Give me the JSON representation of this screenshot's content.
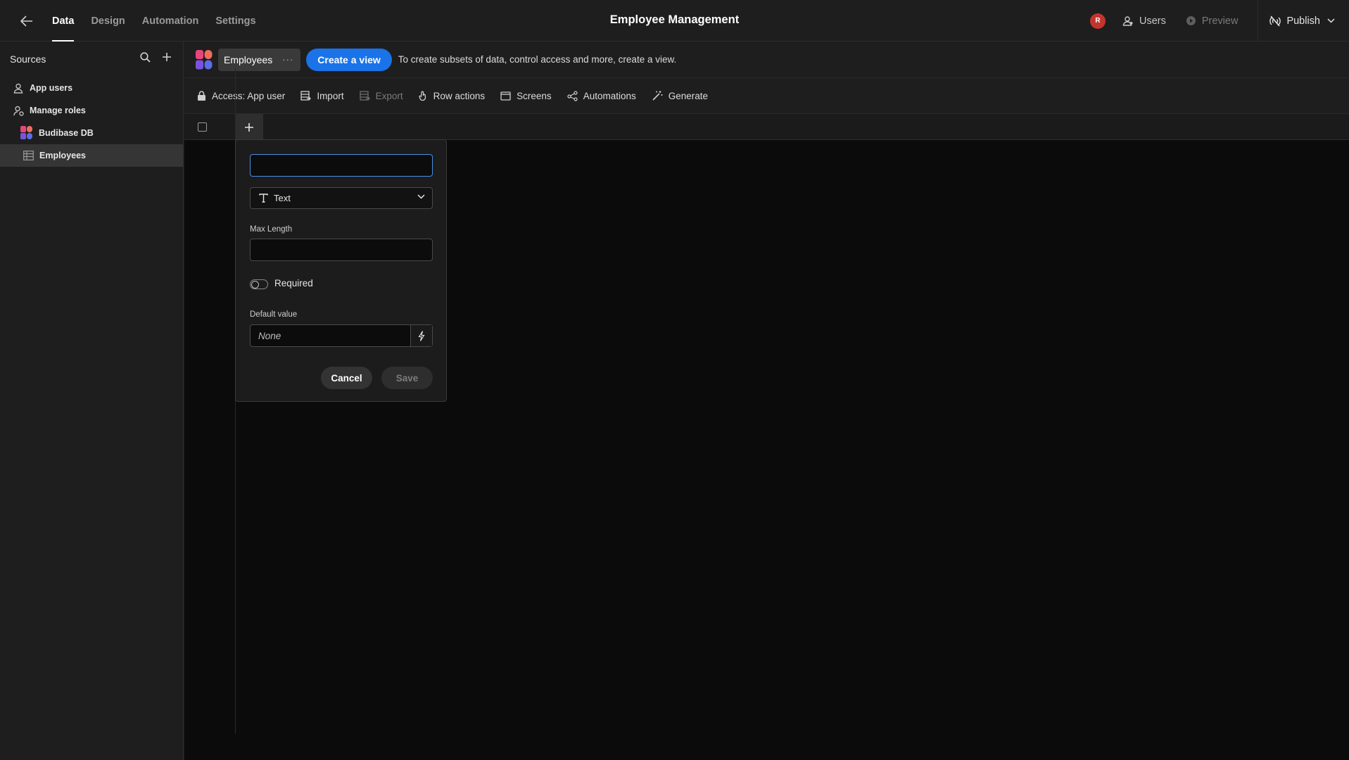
{
  "topbar": {
    "tabs": [
      {
        "label": "Data",
        "active": true
      },
      {
        "label": "Design",
        "active": false
      },
      {
        "label": "Automation",
        "active": false
      },
      {
        "label": "Settings",
        "active": false
      }
    ],
    "app_title": "Employee Management",
    "avatar_initial": "R",
    "users_label": "Users",
    "preview_label": "Preview",
    "publish_label": "Publish"
  },
  "sidebar": {
    "title": "Sources",
    "items": [
      {
        "label": "App users",
        "icon": "user-icon"
      },
      {
        "label": "Manage roles",
        "icon": "roles-icon"
      },
      {
        "label": "Budibase DB",
        "icon": "budibase-logo",
        "expanded": true
      },
      {
        "label": "Employees",
        "icon": "table-icon",
        "selected": true
      }
    ]
  },
  "main": {
    "table_name": "Employees",
    "more_label": "···",
    "create_view_label": "Create a view",
    "hint": "To create subsets of data, control access and more, create a view.",
    "toolbar": [
      {
        "label": "Access: App user",
        "icon": "lock-icon",
        "disabled": false
      },
      {
        "label": "Import",
        "icon": "import-icon",
        "disabled": false
      },
      {
        "label": "Export",
        "icon": "export-icon",
        "disabled": true
      },
      {
        "label": "Row actions",
        "icon": "row-actions-icon",
        "disabled": false
      },
      {
        "label": "Screens",
        "icon": "screens-icon",
        "disabled": false
      },
      {
        "label": "Automations",
        "icon": "automations-icon",
        "disabled": false
      },
      {
        "label": "Generate",
        "icon": "magic-wand-icon",
        "disabled": false
      }
    ]
  },
  "popover": {
    "name_value": "",
    "type_label": "Text",
    "max_length_label": "Max Length",
    "max_length_value": "",
    "required_label": "Required",
    "required_on": false,
    "default_value_label": "Default value",
    "default_value_placeholder": "None",
    "cancel_label": "Cancel",
    "save_label": "Save"
  },
  "colors": {
    "accent": "#1a73e8",
    "avatar": "#c2352e",
    "focus_border": "#4a8fe3"
  }
}
